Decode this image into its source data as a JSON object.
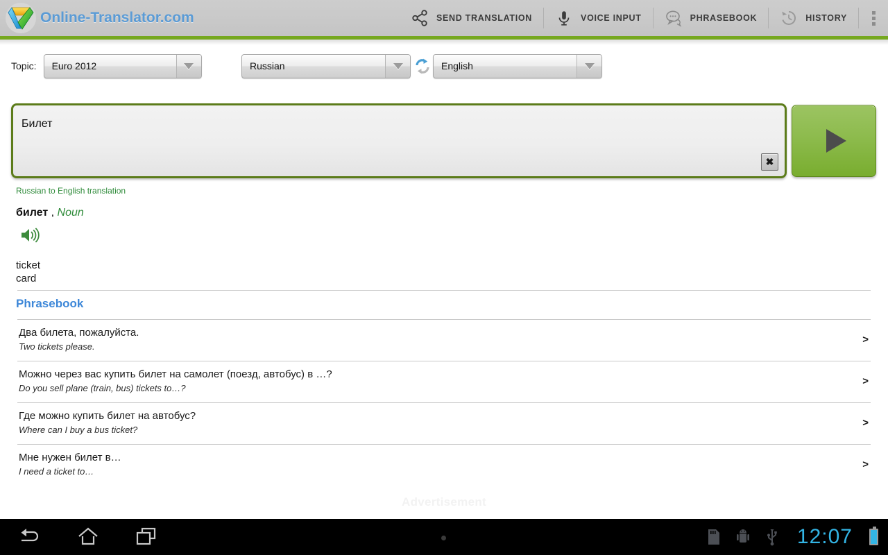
{
  "header": {
    "brand_title": "Online-Translator.com",
    "logo_icon": "translator-logo-icon",
    "actions": [
      {
        "label": "SEND TRANSLATION",
        "icon": "share-icon"
      },
      {
        "label": "VOICE INPUT",
        "icon": "microphone-icon"
      },
      {
        "label": "PHRASEBOOK",
        "icon": "speech-bubbles-icon"
      },
      {
        "label": "HISTORY",
        "icon": "history-clock-icon"
      }
    ],
    "overflow_icon": "overflow-menu-icon",
    "accent_color": "#76a81f"
  },
  "selectors": {
    "topic_label": "Topic:",
    "topic_value": "Euro 2012",
    "source_language": "Russian",
    "target_language": "English",
    "swap_icon": "swap-languages-icon"
  },
  "input": {
    "value": "Билет",
    "placeholder": "",
    "clear_icon": "✖",
    "translate_icon": "play-triangle-icon"
  },
  "result": {
    "direction_note": "Russian to English translation",
    "headword": "билет",
    "comma": " , ",
    "part_of_speech": "Noun",
    "speaker_icon": "speaker-sound-icon",
    "senses": "ticket\ncard"
  },
  "phrasebook": {
    "title": "Phrasebook",
    "chevron": ">",
    "entries": [
      {
        "source": "Два билета, пожалуйста.",
        "target": "Two tickets please."
      },
      {
        "source": "Можно через вас купить билет на самолет (поезд, автобус) в …?",
        "target": "Do you sell plane (train, bus) tickets to…?"
      },
      {
        "source": "Где можно купить билет на автобус?",
        "target": "Where can I buy a bus ticket?"
      },
      {
        "source": "Мне нужен билет в…",
        "target": "I need a ticket to…"
      }
    ]
  },
  "advertisement": {
    "label": "Advertisement"
  },
  "navbar": {
    "back_icon": "back-arrow-icon",
    "home_icon": "home-icon",
    "recents_icon": "recent-apps-icon",
    "menu_dot_icon": "menu-dot-icon",
    "sdcard_icon": "sd-card-icon",
    "android_debug_icon": "android-debug-icon",
    "usb_icon": "usb-icon",
    "clock": "12:07",
    "battery_icon": "battery-icon",
    "clock_color": "#33b5e5"
  }
}
